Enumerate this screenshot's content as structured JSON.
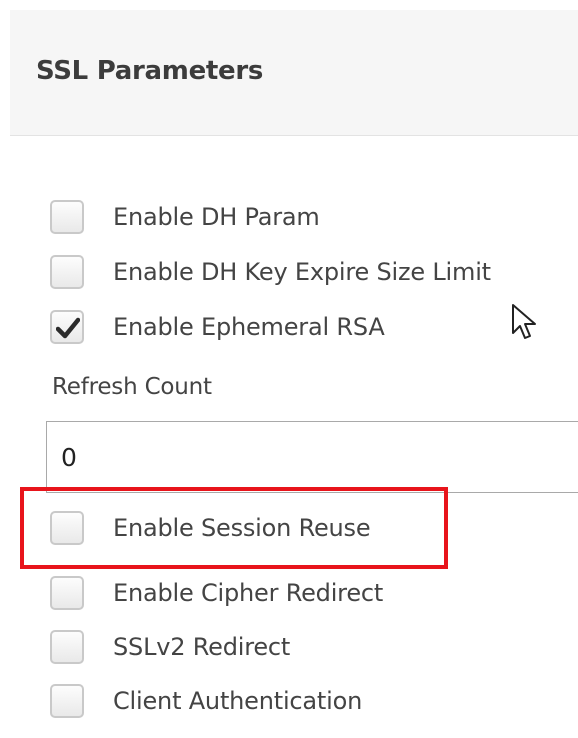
{
  "panel": {
    "title": "SSL Parameters"
  },
  "options_top": [
    {
      "label": "Enable DH Param",
      "checked": false
    },
    {
      "label": "Enable DH Key Expire Size Limit",
      "checked": false
    },
    {
      "label": "Enable Ephemeral RSA",
      "checked": true
    }
  ],
  "refresh_count": {
    "label": "Refresh Count",
    "value": "0"
  },
  "options_bottom": [
    {
      "label": "Enable Session Reuse",
      "checked": false,
      "highlighted": true
    },
    {
      "label": "Enable Cipher Redirect",
      "checked": false
    },
    {
      "label": "SSLv2 Redirect",
      "checked": false
    },
    {
      "label": "Client Authentication",
      "checked": false
    }
  ],
  "colors": {
    "header_bg": "#f6f6f6",
    "highlight": "#e8141b",
    "text": "#444444"
  },
  "icons": {
    "checkmark": "checkmark-icon",
    "cursor": "mouse-pointer-icon"
  }
}
